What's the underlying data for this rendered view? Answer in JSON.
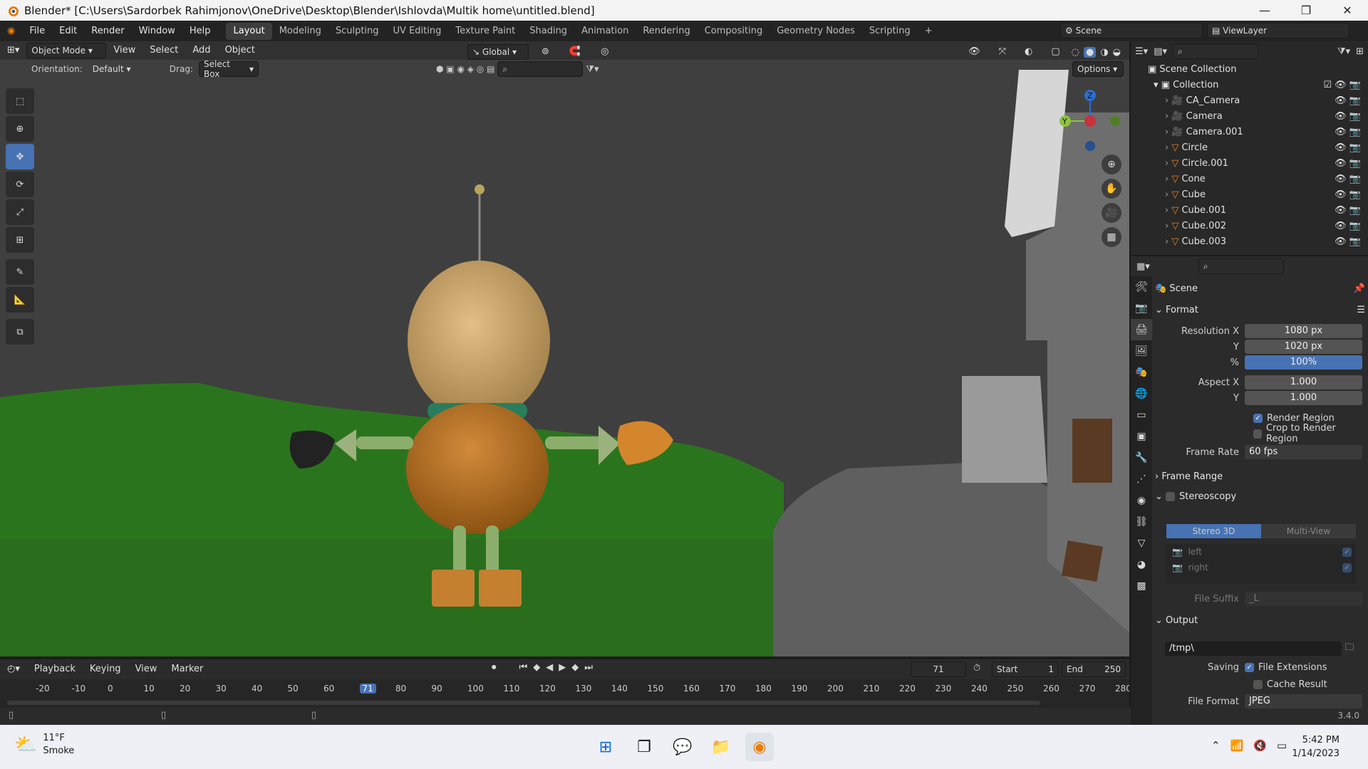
{
  "window": {
    "title": "Blender* [C:\\Users\\Sardorbek Rahimjonov\\OneDrive\\Desktop\\Blender\\Ishlovda\\Multik home\\untitled.blend]",
    "minimize": "—",
    "maximize": "❐",
    "close": "✕"
  },
  "menu": {
    "items": [
      "File",
      "Edit",
      "Render",
      "Window",
      "Help"
    ]
  },
  "workspaces": [
    "Layout",
    "Modeling",
    "Sculpting",
    "UV Editing",
    "Texture Paint",
    "Shading",
    "Animation",
    "Rendering",
    "Compositing",
    "Geometry Nodes",
    "Scripting"
  ],
  "active_workspace": "Layout",
  "add_workspace": "+",
  "scene": "Scene",
  "view_layer": "ViewLayer",
  "viewport": {
    "mode": "Object Mode",
    "menus": [
      "View",
      "Select",
      "Add",
      "Object"
    ],
    "transform_orientation": "Global",
    "orientation_label": "Orientation:",
    "orientation_value": "Default",
    "drag_label": "Drag:",
    "drag_value": "Select Box",
    "options": "Options",
    "gizmo": {
      "z": "Z",
      "y": "Y"
    }
  },
  "outliner": {
    "root": "Scene Collection",
    "collection": "Collection",
    "items": [
      {
        "name": "CA_Camera",
        "type": "camera"
      },
      {
        "name": "Camera",
        "type": "camera"
      },
      {
        "name": "Camera.001",
        "type": "camera"
      },
      {
        "name": "Circle",
        "type": "mesh"
      },
      {
        "name": "Circle.001",
        "type": "mesh"
      },
      {
        "name": "Cone",
        "type": "mesh"
      },
      {
        "name": "Cube",
        "type": "mesh"
      },
      {
        "name": "Cube.001",
        "type": "mesh"
      },
      {
        "name": "Cube.002",
        "type": "mesh"
      },
      {
        "name": "Cube.003",
        "type": "mesh"
      }
    ]
  },
  "properties": {
    "scene_name": "Scene",
    "format": {
      "title": "Format",
      "res_x_label": "Resolution X",
      "res_x": "1080 px",
      "res_y_label": "Y",
      "res_y": "1020 px",
      "pct_label": "%",
      "pct": "100%",
      "aspect_x_label": "Aspect X",
      "aspect_x": "1.000",
      "aspect_y_label": "Y",
      "aspect_y": "1.000",
      "render_region": "Render Region",
      "crop": "Crop to Render Region",
      "frame_rate_label": "Frame Rate",
      "frame_rate": "60 fps"
    },
    "frame_range": "Frame Range",
    "stereoscopy": {
      "title": "Stereoscopy",
      "stereo3d": "Stereo 3D",
      "multiview": "Multi-View",
      "left": "left",
      "right": "right",
      "file_suffix_label": "File Suffix",
      "file_suffix": "_L"
    },
    "output": {
      "title": "Output",
      "path": "/tmp\\",
      "saving_label": "Saving",
      "file_ext": "File Extensions",
      "cache": "Cache Result",
      "file_format_label": "File Format",
      "file_format": "JPEG"
    }
  },
  "timeline": {
    "menus": [
      "Playback",
      "Keying",
      "View",
      "Marker"
    ],
    "current_frame": "71",
    "start_label": "Start",
    "start": "1",
    "end_label": "End",
    "end": "250",
    "ticks": [
      "-20",
      "-10",
      "0",
      "10",
      "20",
      "30",
      "40",
      "50",
      "60",
      "71",
      "80",
      "90",
      "100",
      "110",
      "120",
      "130",
      "140",
      "150",
      "160",
      "170",
      "180",
      "190",
      "200",
      "210",
      "220",
      "230",
      "240",
      "250",
      "260",
      "270",
      "280"
    ]
  },
  "status": {
    "version": "3.4.0"
  },
  "taskbar": {
    "temp": "11°F",
    "weather": "Smoke",
    "time": "5:42 PM",
    "date": "1/14/2023"
  }
}
